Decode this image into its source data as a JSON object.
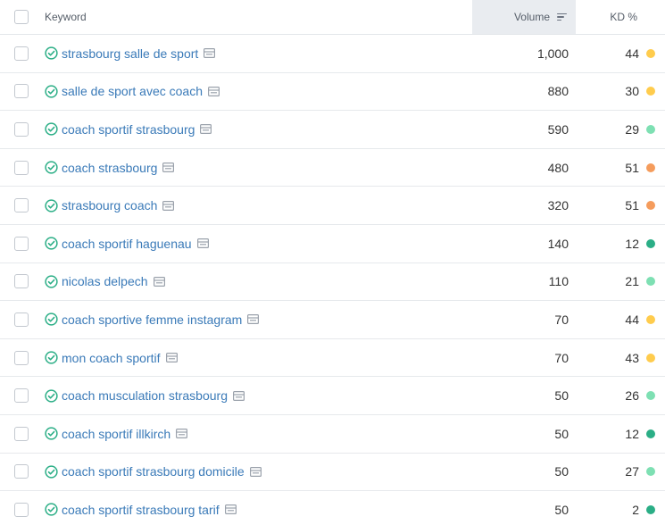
{
  "header": {
    "keyword_label": "Keyword",
    "volume_label": "Volume",
    "kd_label": "KD %"
  },
  "kd_colors": {
    "easy": "#2bae86",
    "moderate": "#7ee0b3",
    "medium": "#ffcc4d",
    "hard": "#f59c5c"
  },
  "rows": [
    {
      "keyword": "strasbourg salle de sport",
      "volume": "1,000",
      "kd": "44",
      "kd_color": "#ffcc4d"
    },
    {
      "keyword": "salle de sport avec coach",
      "volume": "880",
      "kd": "30",
      "kd_color": "#ffcc4d"
    },
    {
      "keyword": "coach sportif strasbourg",
      "volume": "590",
      "kd": "29",
      "kd_color": "#7ee0b3"
    },
    {
      "keyword": "coach strasbourg",
      "volume": "480",
      "kd": "51",
      "kd_color": "#f59c5c"
    },
    {
      "keyword": "strasbourg coach",
      "volume": "320",
      "kd": "51",
      "kd_color": "#f59c5c"
    },
    {
      "keyword": "coach sportif haguenau",
      "volume": "140",
      "kd": "12",
      "kd_color": "#2bae86"
    },
    {
      "keyword": "nicolas delpech",
      "volume": "110",
      "kd": "21",
      "kd_color": "#7ee0b3"
    },
    {
      "keyword": "coach sportive femme instagram",
      "volume": "70",
      "kd": "44",
      "kd_color": "#ffcc4d"
    },
    {
      "keyword": "mon coach sportif",
      "volume": "70",
      "kd": "43",
      "kd_color": "#ffcc4d"
    },
    {
      "keyword": "coach musculation strasbourg",
      "volume": "50",
      "kd": "26",
      "kd_color": "#7ee0b3"
    },
    {
      "keyword": "coach sportif illkirch",
      "volume": "50",
      "kd": "12",
      "kd_color": "#2bae86"
    },
    {
      "keyword": "coach sportif strasbourg domicile",
      "volume": "50",
      "kd": "27",
      "kd_color": "#7ee0b3"
    },
    {
      "keyword": "coach sportif strasbourg tarif",
      "volume": "50",
      "kd": "2",
      "kd_color": "#2bae86"
    }
  ],
  "icons": {
    "row_status": "check-circle-icon",
    "serp": "serp-features-icon",
    "sort": "sort-descending-icon"
  }
}
